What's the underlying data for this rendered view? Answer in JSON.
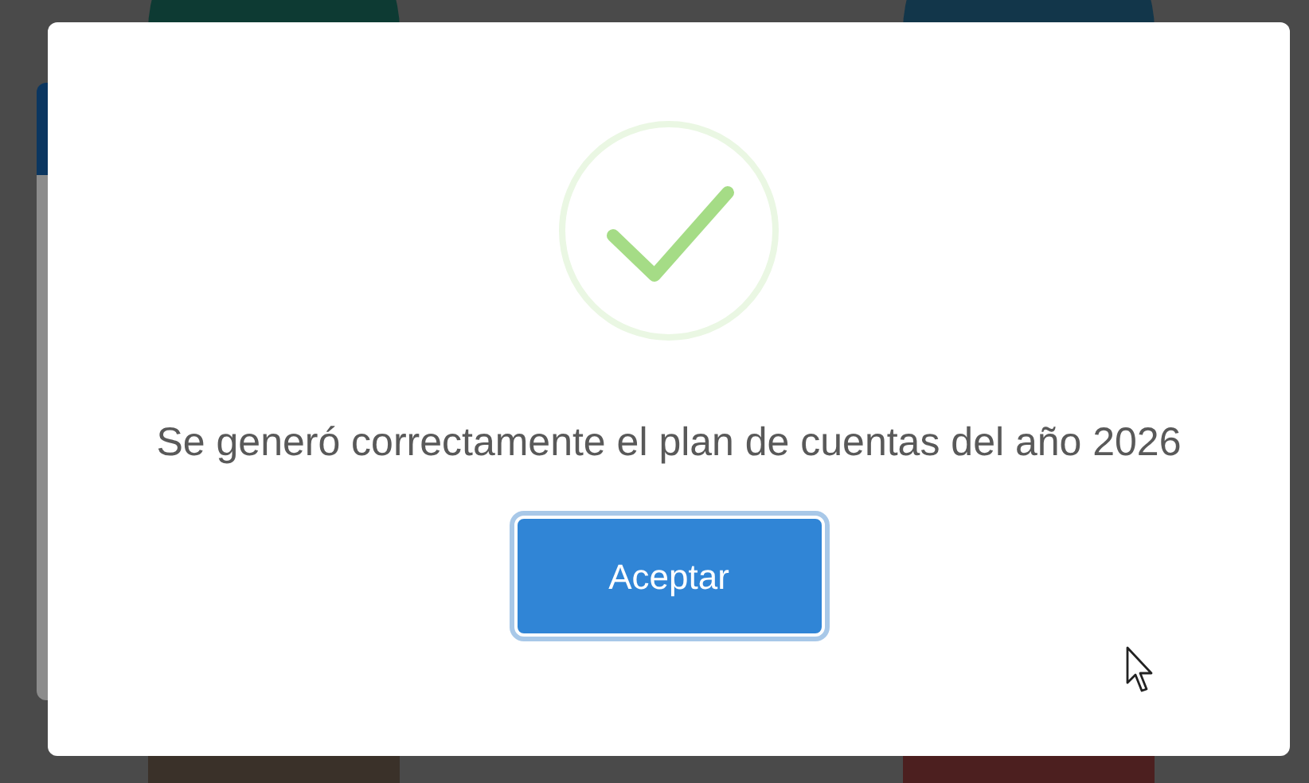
{
  "dialog": {
    "message": "Se generó correctamente el plan de cuentas del año 2026",
    "confirm_button": {
      "label": "Aceptar",
      "focused": true
    }
  }
}
